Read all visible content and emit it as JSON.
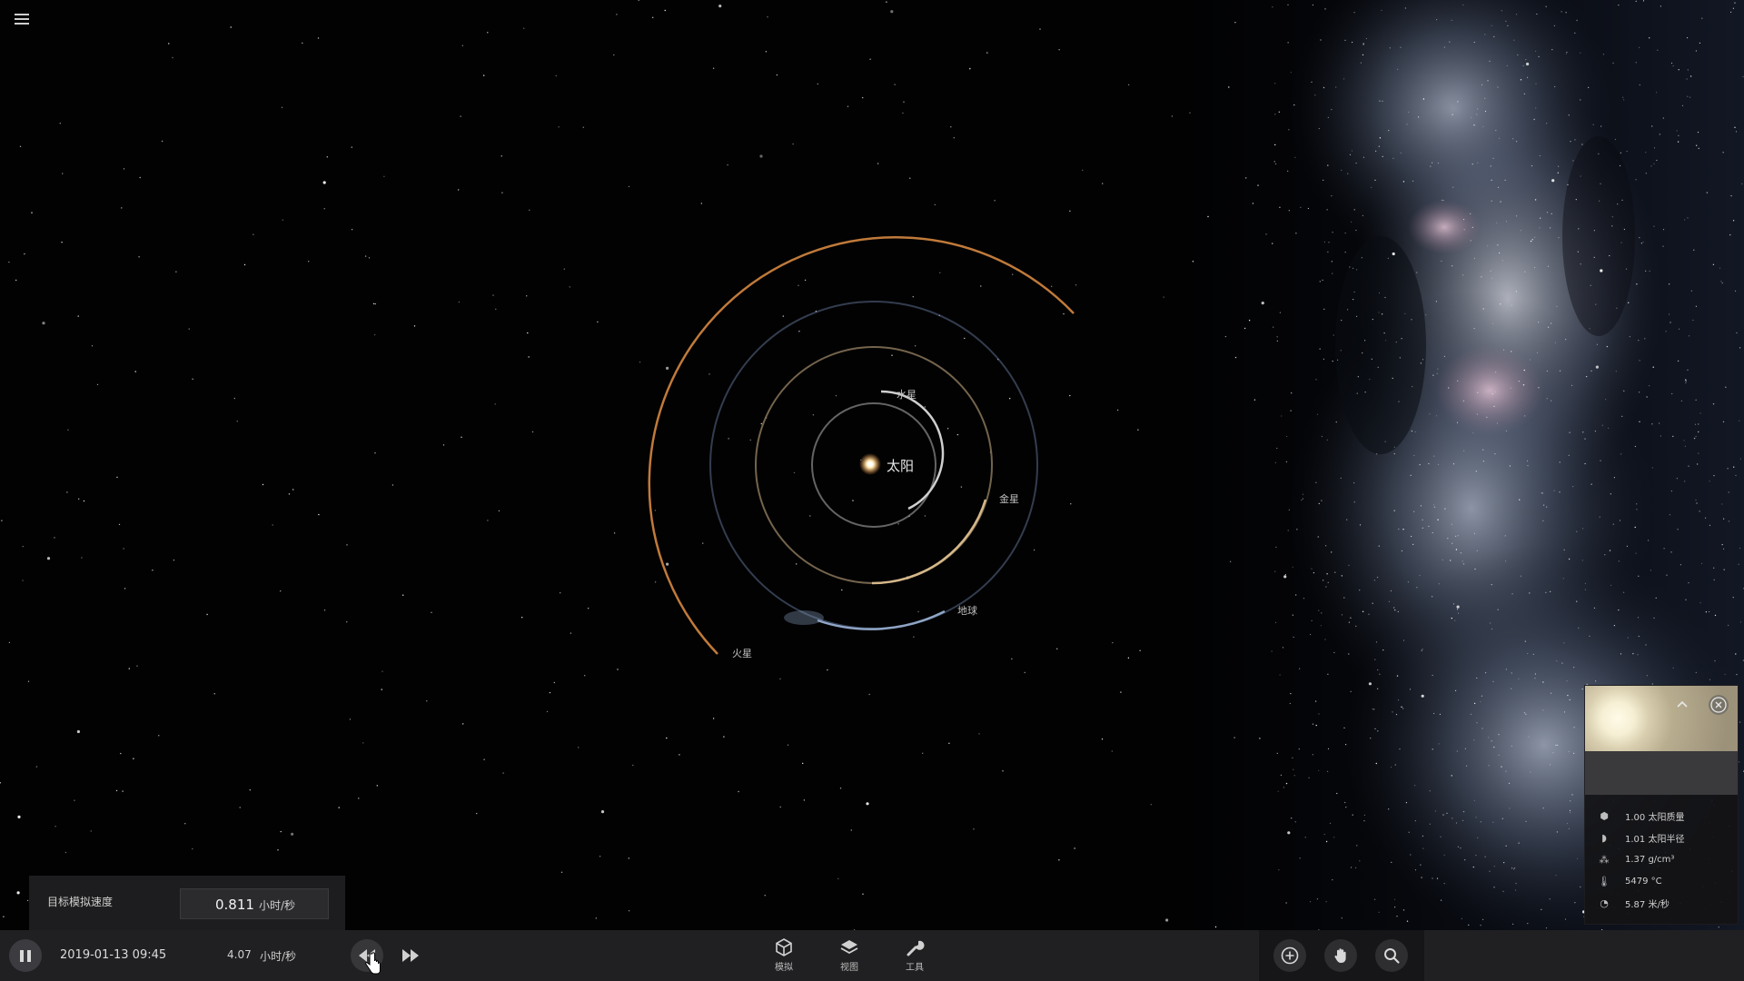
{
  "menu": {
    "icon": "hamburger-menu-icon"
  },
  "scene": {
    "sun_label": "太阳",
    "planets": [
      {
        "key": "mercury",
        "label": "水星",
        "color": "#9a9a9a"
      },
      {
        "key": "venus",
        "label": "金星",
        "color": "#c7a878"
      },
      {
        "key": "earth",
        "label": "地球",
        "color": "#7f95b6"
      },
      {
        "key": "mars",
        "label": "火星",
        "color": "#c27a3a"
      }
    ]
  },
  "info_panel": {
    "collapse_icon": "chevron-up-icon",
    "close_icon": "close-icon",
    "stats": [
      {
        "icon": "mass-cube-icon",
        "value": "1.00 太阳质量"
      },
      {
        "icon": "radius-icon",
        "value": "1.01 太阳半径"
      },
      {
        "icon": "density-icon",
        "value": "1.37 g/cm³"
      },
      {
        "icon": "thermometer-icon",
        "value": "5479 °C"
      },
      {
        "icon": "gauge-icon",
        "value": "5.87 米/秒"
      }
    ]
  },
  "speed_popup": {
    "label": "目标模拟速度",
    "value": "0.811",
    "unit": "小时/秒"
  },
  "bottom_bar": {
    "datetime": "2019-01-13 09:45",
    "rate_value": "4.07",
    "rate_unit": "小时/秒",
    "tabs": [
      {
        "label": "模拟",
        "icon": "cube-icon"
      },
      {
        "label": "视图",
        "icon": "layers-icon"
      },
      {
        "label": "工具",
        "icon": "wrench-icon"
      }
    ],
    "tools": [
      "add-circle-icon",
      "hand-icon",
      "search-icon"
    ]
  },
  "colors": {
    "bar_bg": "#202022",
    "panel_bg": "#1d1d1f",
    "accent": "#ffffff"
  }
}
